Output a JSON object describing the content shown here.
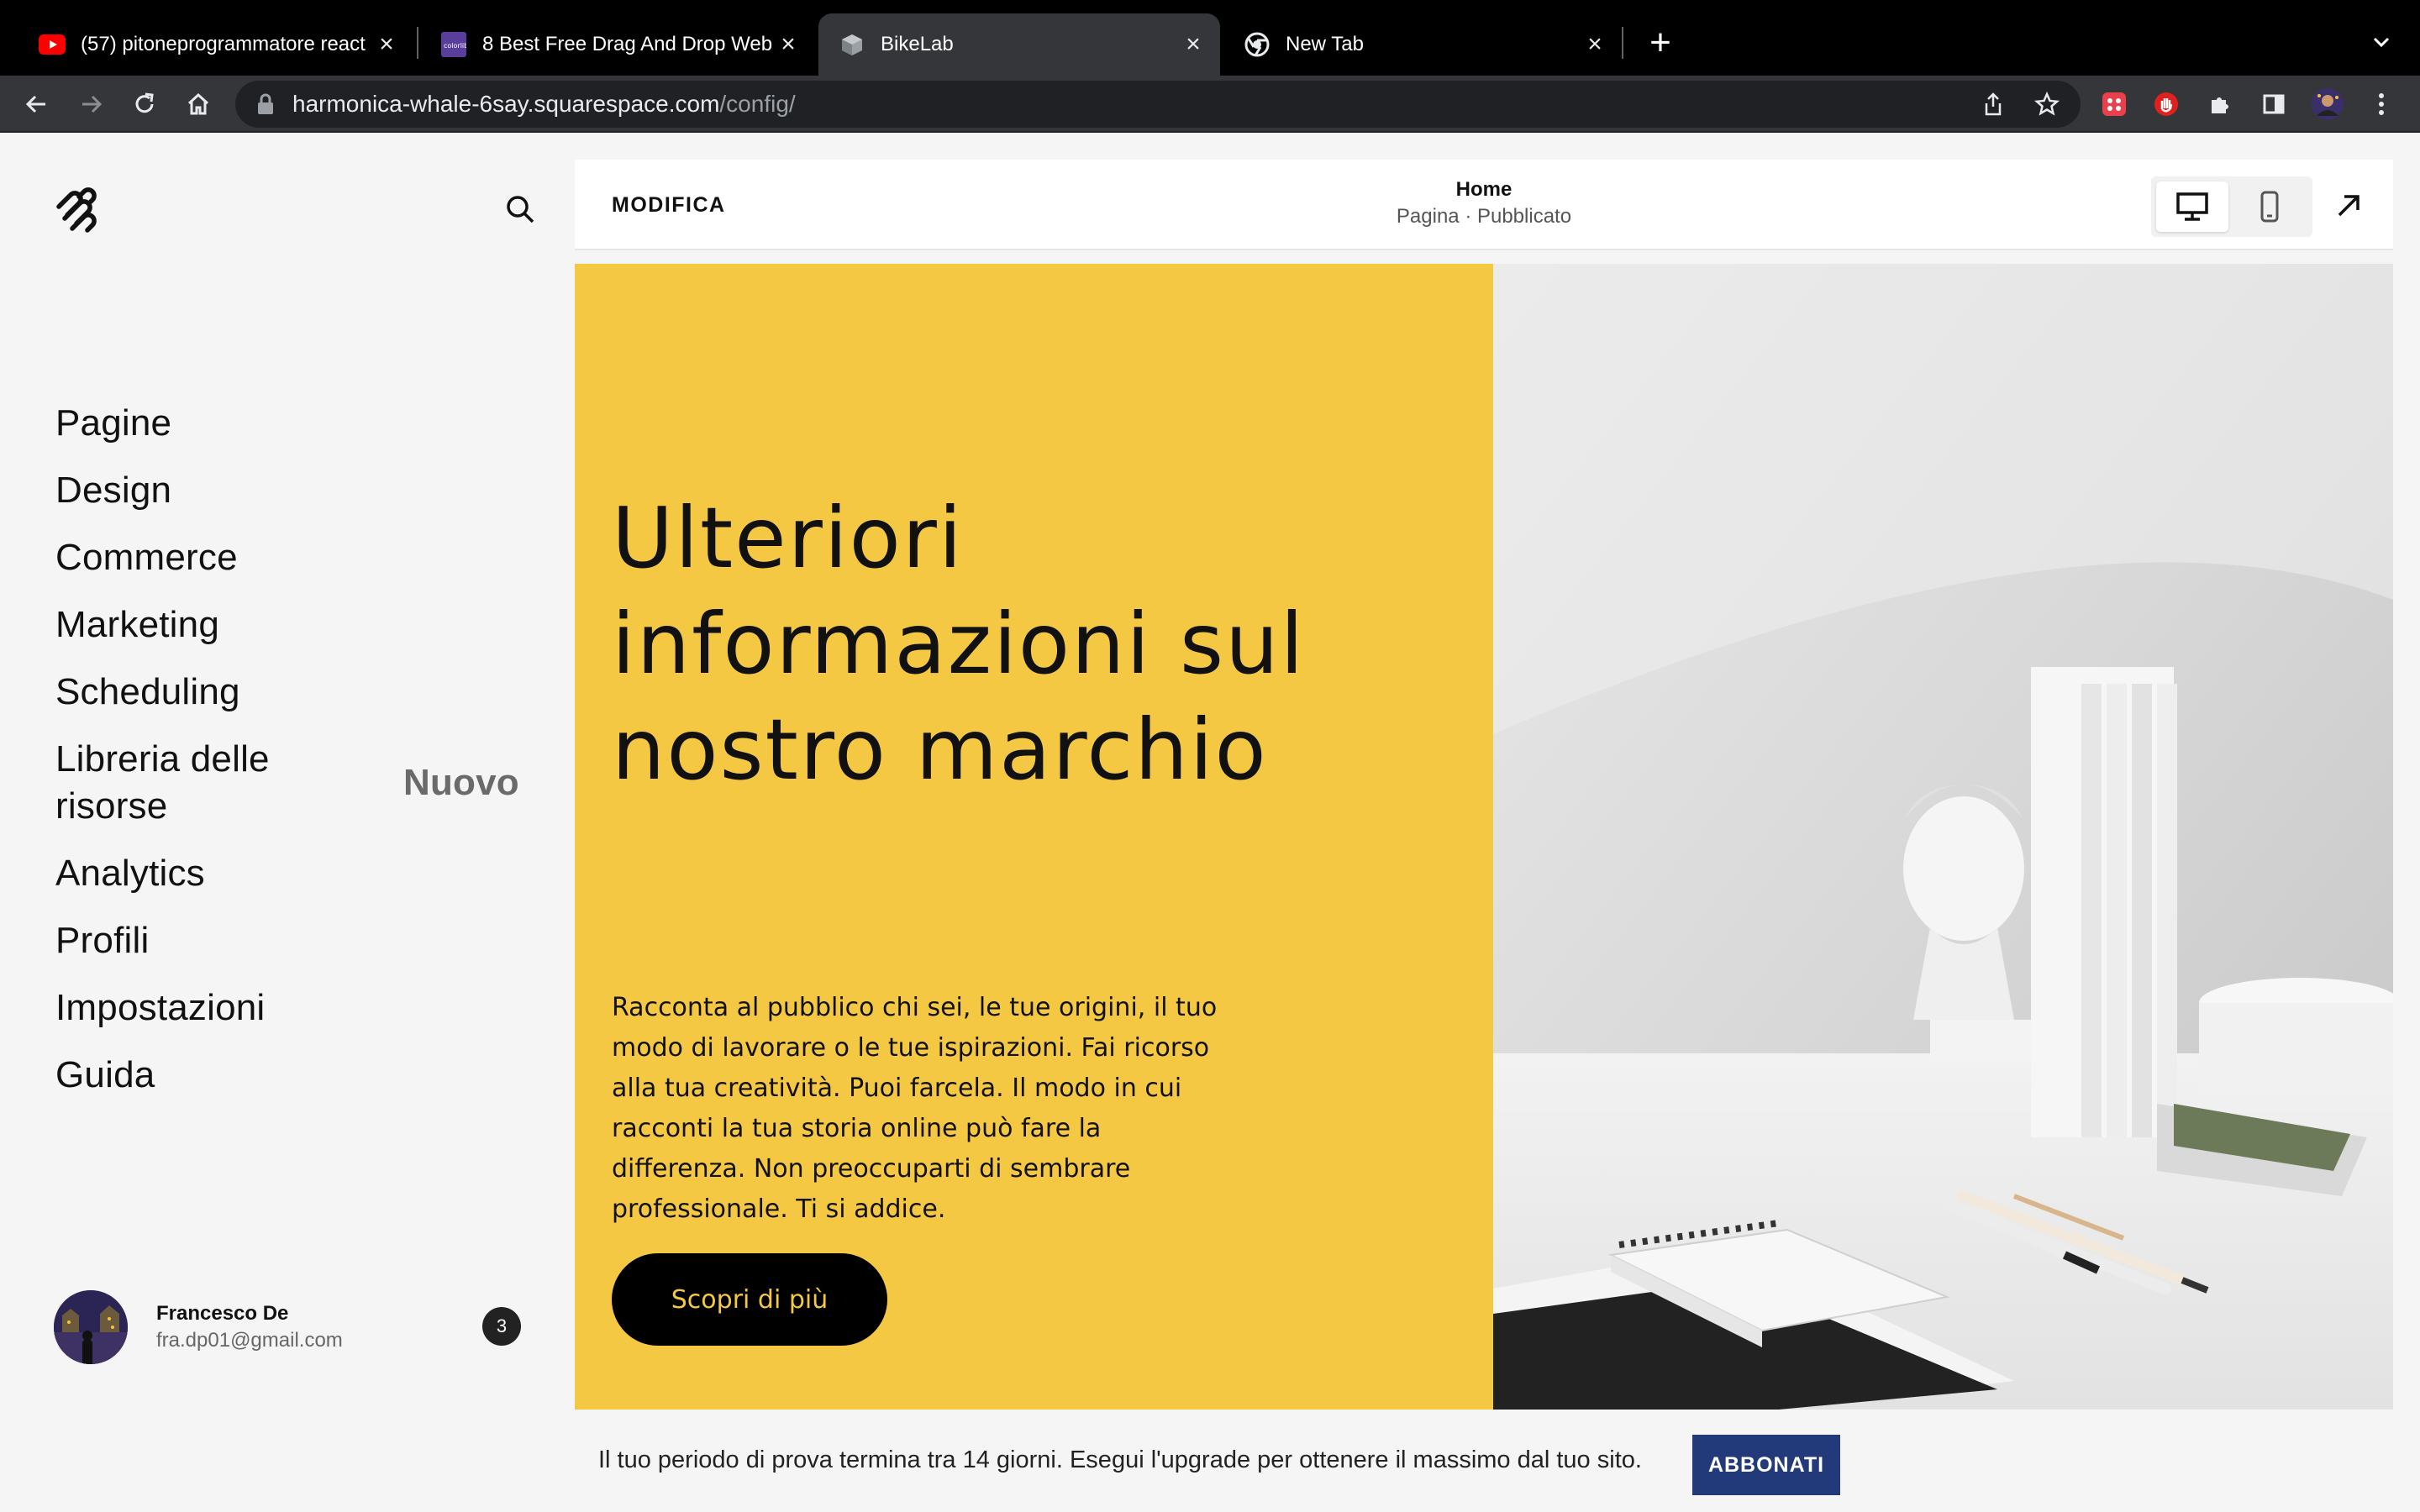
{
  "browser": {
    "tabs": [
      {
        "title": "(57) pitoneprogrammatore react",
        "favicon": "youtube-icon",
        "active": false
      },
      {
        "title": "8 Best Free Drag And Drop Web",
        "favicon": "colorlib-icon",
        "active": false
      },
      {
        "title": "BikeLab",
        "favicon": "cube-icon",
        "active": true
      },
      {
        "title": "New Tab",
        "favicon": "chrome-icon",
        "active": false
      }
    ],
    "url_host": "harmonica-whale-6say.squarespace.com",
    "url_path": "/config/"
  },
  "sidebar": {
    "items": [
      {
        "label": "Pagine"
      },
      {
        "label": "Design"
      },
      {
        "label": "Commerce"
      },
      {
        "label": "Marketing"
      },
      {
        "label": "Scheduling"
      },
      {
        "label": "Libreria delle risorse",
        "badge": "Nuovo"
      },
      {
        "label": "Analytics"
      },
      {
        "label": "Profili"
      },
      {
        "label": "Impostazioni"
      },
      {
        "label": "Guida"
      }
    ],
    "user": {
      "name": "Francesco De",
      "email": "fra.dp01@gmail.com",
      "notifications": "3"
    }
  },
  "editor": {
    "mode_label": "MODIFICA",
    "page_title": "Home",
    "page_status": "Pagina · Pubblicato",
    "active_device": "desktop"
  },
  "hero": {
    "title": "Ulteriori informazioni sul nostro marchio",
    "body": "Racconta al pubblico chi sei, le tue origini, il tuo modo di lavorare o le tue ispirazioni. Fai ricorso alla tua creatività. Puoi farcela. Il modo in cui racconti la tua storia online può fare la differenza. Non preoccuparti di sembrare professionale. Ti si addice.",
    "button_label": "Scopri di più",
    "background_color": "#f5c843"
  },
  "trial": {
    "message": "Il tuo periodo di prova termina tra 14 giorni. Esegui l'upgrade per ottenere il massimo dal tuo sito.",
    "button_label": "ABBONATI",
    "button_color": "#233a7a"
  }
}
